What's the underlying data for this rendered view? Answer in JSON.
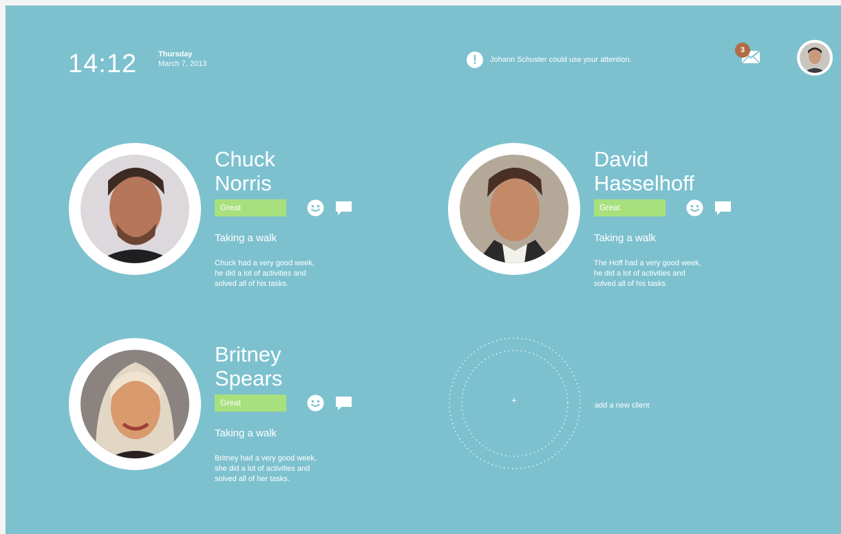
{
  "header": {
    "time": "14:12",
    "weekday": "Thursday",
    "date": "March 7, 2013",
    "notification": "Johann Schuster could use your attention.",
    "alert_glyph": "!",
    "unread_count": "3",
    "icons": {
      "alert": "alert-icon",
      "mail": "mail-icon",
      "avatar": "user-avatar"
    }
  },
  "clients": [
    {
      "name": "Chuck\nNorris",
      "mood": "Great",
      "activity": "Taking a walk",
      "summary": "Chuck had a very good week,\nhe did a lot of activities and\nsolved all of his tasks."
    },
    {
      "name": "David\nHasselhoff",
      "mood": "Great",
      "activity": "Taking a walk",
      "summary": "The Hoff had a very good week,\nhe did a lot of activities and\nsolved all of his tasks."
    },
    {
      "name": "Britney\nSpears",
      "mood": "Great",
      "activity": "Taking a walk",
      "summary": "Britney had a very good week,\nshe did a lot of activities and\nsolved all of her tasks."
    }
  ],
  "add_client": {
    "plus": "+",
    "label": "add a new client"
  },
  "colors": {
    "background": "#7dc1cf",
    "mood_great": "#a8e07e",
    "badge": "#b06c45",
    "text": "#ffffff"
  }
}
